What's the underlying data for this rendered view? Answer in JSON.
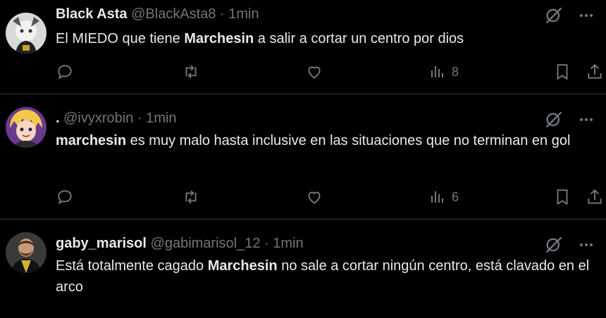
{
  "colors": {
    "background": "#000000",
    "text": "#e7e9ea",
    "muted": "#71767b",
    "divider": "#2f3336"
  },
  "tweets": [
    {
      "name": "Black Asta",
      "handle": "@BlackAsta8",
      "separator": "·",
      "time": "1min",
      "text_parts": [
        "El MIEDO que tiene ",
        "Marchesin",
        " a salir a cortar un centro por dios"
      ],
      "views": "8",
      "icons": [
        "grok-icon",
        "more-icon",
        "reply-icon",
        "retweet-icon",
        "like-icon",
        "views-icon",
        "bookmark-icon",
        "share-icon"
      ]
    },
    {
      "name": ".",
      "handle": "@ivyxrobin",
      "separator": "·",
      "time": "1min",
      "text_parts": [
        "",
        "marchesin",
        " es muy malo hasta inclusive en las situaciones que no terminan en gol"
      ],
      "views": "6",
      "icons": [
        "grok-icon",
        "more-icon",
        "reply-icon",
        "retweet-icon",
        "like-icon",
        "views-icon",
        "bookmark-icon",
        "share-icon"
      ]
    },
    {
      "name": "gaby_marisol",
      "handle": "@gabimarisol_12",
      "separator": "·",
      "time": "1min",
      "text_parts": [
        "Está totalmente cagado ",
        "Marchesin",
        " no sale a cortar ningún centro, está clavado en el arco"
      ],
      "icons": [
        "grok-icon",
        "more-icon"
      ]
    }
  ]
}
